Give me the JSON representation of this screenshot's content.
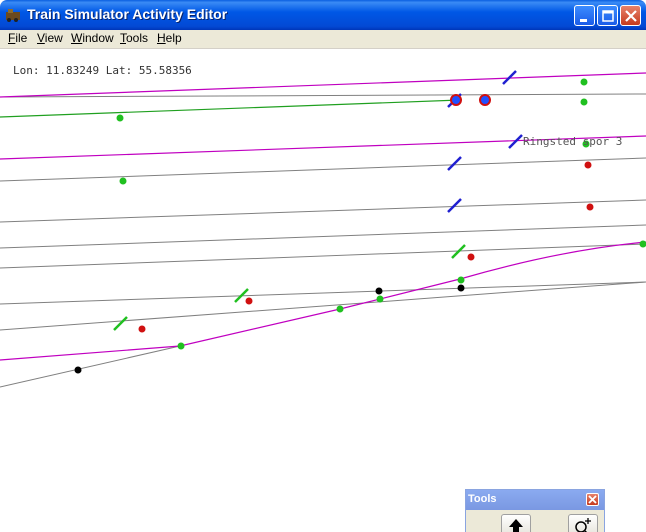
{
  "window": {
    "title": "Train Simulator Activity Editor",
    "icon": "app-train-icon",
    "controls": [
      "minimize-icon",
      "maximize-icon",
      "close-icon"
    ]
  },
  "menu": {
    "items": [
      {
        "label": "File",
        "underline": "F"
      },
      {
        "label": "View",
        "underline": "V"
      },
      {
        "label": "Window",
        "underline": "W"
      },
      {
        "label": "Tools",
        "underline": "T"
      },
      {
        "label": "Help",
        "underline": "H"
      }
    ]
  },
  "canvas": {
    "coordinates": "Lon: 11.83249 Lat: 55.58356",
    "track_label": "Ringsted spor 3",
    "colors": {
      "background": "#ffffff",
      "track": "#808080",
      "path": "#c000c0",
      "player_path": "#20a020",
      "signal_blue": "#2020d0",
      "signal_green": "#20c020",
      "node_green": "#20c020",
      "node_red": "#d01010",
      "node_black": "#000000"
    }
  },
  "tools_panel": {
    "title": "Tools",
    "buttons": [
      "up-arrow-icon",
      "zoom-in-icon"
    ]
  }
}
